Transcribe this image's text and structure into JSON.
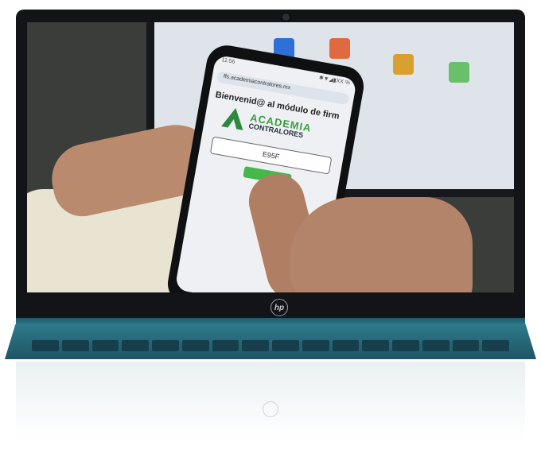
{
  "phone_screen": {
    "status_time": "11:56",
    "status_icons": "✱▼◢▮XX %",
    "url": "ffs.academiacontralores.mx",
    "welcome_text": "Bienvenid@ al módulo de firm",
    "brand_line1": "ACADEMIA",
    "brand_line2": "CONTRALORES",
    "code_value": "E95F"
  },
  "laptop": {
    "logo_text": "hp"
  },
  "colors": {
    "deck": "#2e7a8c",
    "brand_green": "#3a9d3f",
    "button_green": "#46b84a",
    "bezel": "#121418"
  }
}
